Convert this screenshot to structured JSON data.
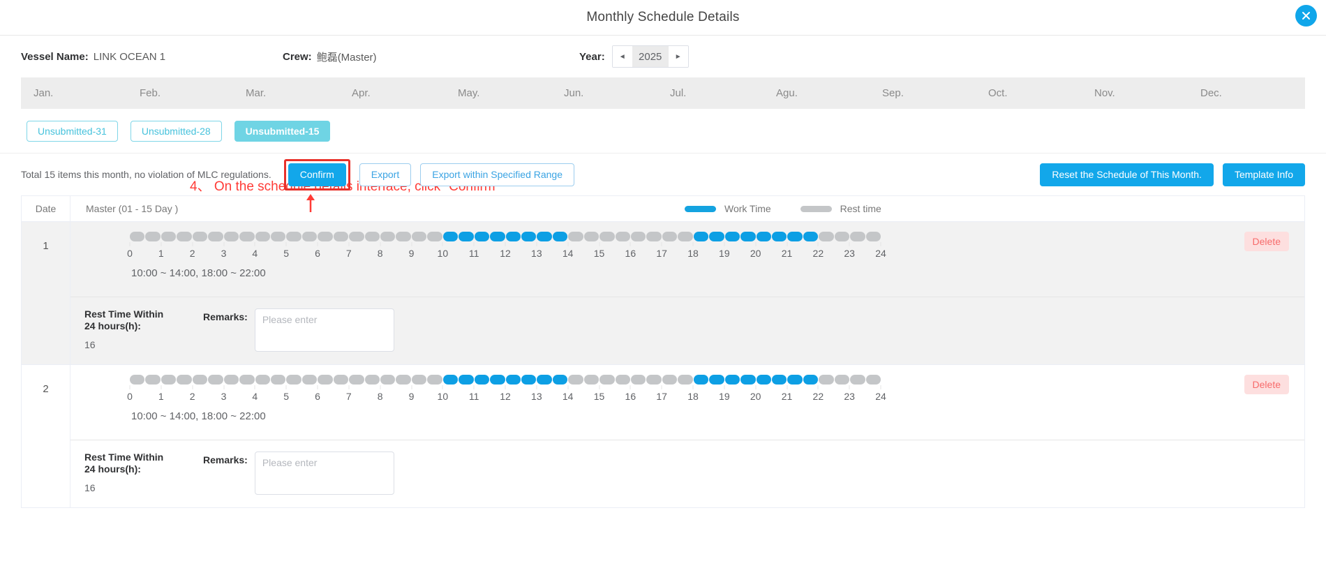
{
  "header": {
    "title": "Monthly Schedule Details",
    "close_icon": "close-icon"
  },
  "info": {
    "vessel_label": "Vessel Name:",
    "vessel_value": "LINK OCEAN 1",
    "crew_label": "Crew:",
    "crew_value": "鲍磊(Master)",
    "year_label": "Year:",
    "year_value": "2025",
    "prev_icon": "chevron-left-icon",
    "next_icon": "chevron-right-icon"
  },
  "months": [
    {
      "label": "Jan.",
      "active": false
    },
    {
      "label": "Feb.",
      "active": false
    },
    {
      "label": "Mar.",
      "active": false
    },
    {
      "label": "Apr.",
      "active": false
    },
    {
      "label": "May.",
      "active": false
    },
    {
      "label": "Jun.",
      "active": false
    },
    {
      "label": "Jul.",
      "active": false
    },
    {
      "label": "Agu.",
      "active": false
    },
    {
      "label": "Sep.",
      "active": false
    },
    {
      "label": "Oct.",
      "active": false
    },
    {
      "label": "Nov.",
      "active": false
    },
    {
      "label": "Dec.",
      "active": false
    }
  ],
  "chips": [
    {
      "label": "Unsubmitted-31",
      "active": false
    },
    {
      "label": "Unsubmitted-28",
      "active": false
    },
    {
      "label": "Unsubmitted-15",
      "active": true
    }
  ],
  "annotation": {
    "text": "4、 On the schedule details interface, click \"Confirm\"",
    "color": "#ff3b36"
  },
  "toolbar": {
    "total_text": "Total 15 items this month, no violation of MLC regulations.",
    "confirm_label": "Confirm",
    "export_label": "Export",
    "export_range_label": "Export within Specified Range",
    "reset_label": "Reset the Schedule of This Month.",
    "template_label": "Template Info"
  },
  "table": {
    "col_date": "Date",
    "col_main": "Master (01 - 15 Day )",
    "legend": [
      {
        "label": "Work Time",
        "color": "#14a3e0"
      },
      {
        "label": "Rest time",
        "color": "#c4c6c8"
      }
    ],
    "hour_ticks": [
      "0",
      "1",
      "2",
      "3",
      "4",
      "5",
      "6",
      "7",
      "8",
      "9",
      "10",
      "11",
      "12",
      "13",
      "14",
      "15",
      "16",
      "17",
      "18",
      "19",
      "20",
      "21",
      "22",
      "23",
      "24"
    ],
    "rest_label": "Rest Time Within 24 hours(h):",
    "remarks_label": "Remarks:",
    "remarks_placeholder": "Please enter",
    "delete_label": "Delete",
    "rows": [
      {
        "date": "1",
        "range_text": "10:00 ~ 14:00, 18:00 ~ 22:00",
        "work_intervals": [
          [
            10,
            14
          ],
          [
            18,
            22
          ]
        ],
        "rest_hours": "16",
        "remarks_value": ""
      },
      {
        "date": "2",
        "range_text": "10:00 ~ 14:00, 18:00 ~ 22:00",
        "work_intervals": [
          [
            10,
            14
          ],
          [
            18,
            22
          ]
        ],
        "rest_hours": "16",
        "remarks_value": ""
      }
    ]
  }
}
